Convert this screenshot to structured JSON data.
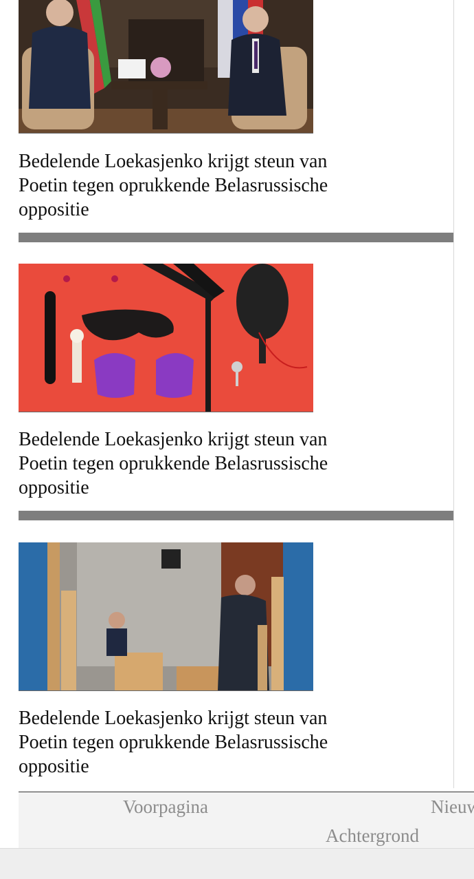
{
  "articles": [
    {
      "headline": "Bedelende Loekasjenko krijgt steun van Poetin tegen oprukkende Belasrussische oppositie",
      "image": "leaders-meeting-photo"
    },
    {
      "headline": "Bedelende Loekasjenko krijgt steun van Poetin tegen oprukkende Belasrussische oppositie",
      "image": "accessories-flatlay-photo"
    },
    {
      "headline": "Bedelende Loekasjenko krijgt steun van Poetin tegen oprukkende Belasrussische oppositie",
      "image": "parliament-debate-photo"
    }
  ],
  "footer_nav": {
    "items": [
      "Voorpagina",
      "Nieuws",
      "Achtergrond"
    ]
  },
  "colors": {
    "divider": "#7e7e7e",
    "nav_link": "#8c8c8c"
  }
}
